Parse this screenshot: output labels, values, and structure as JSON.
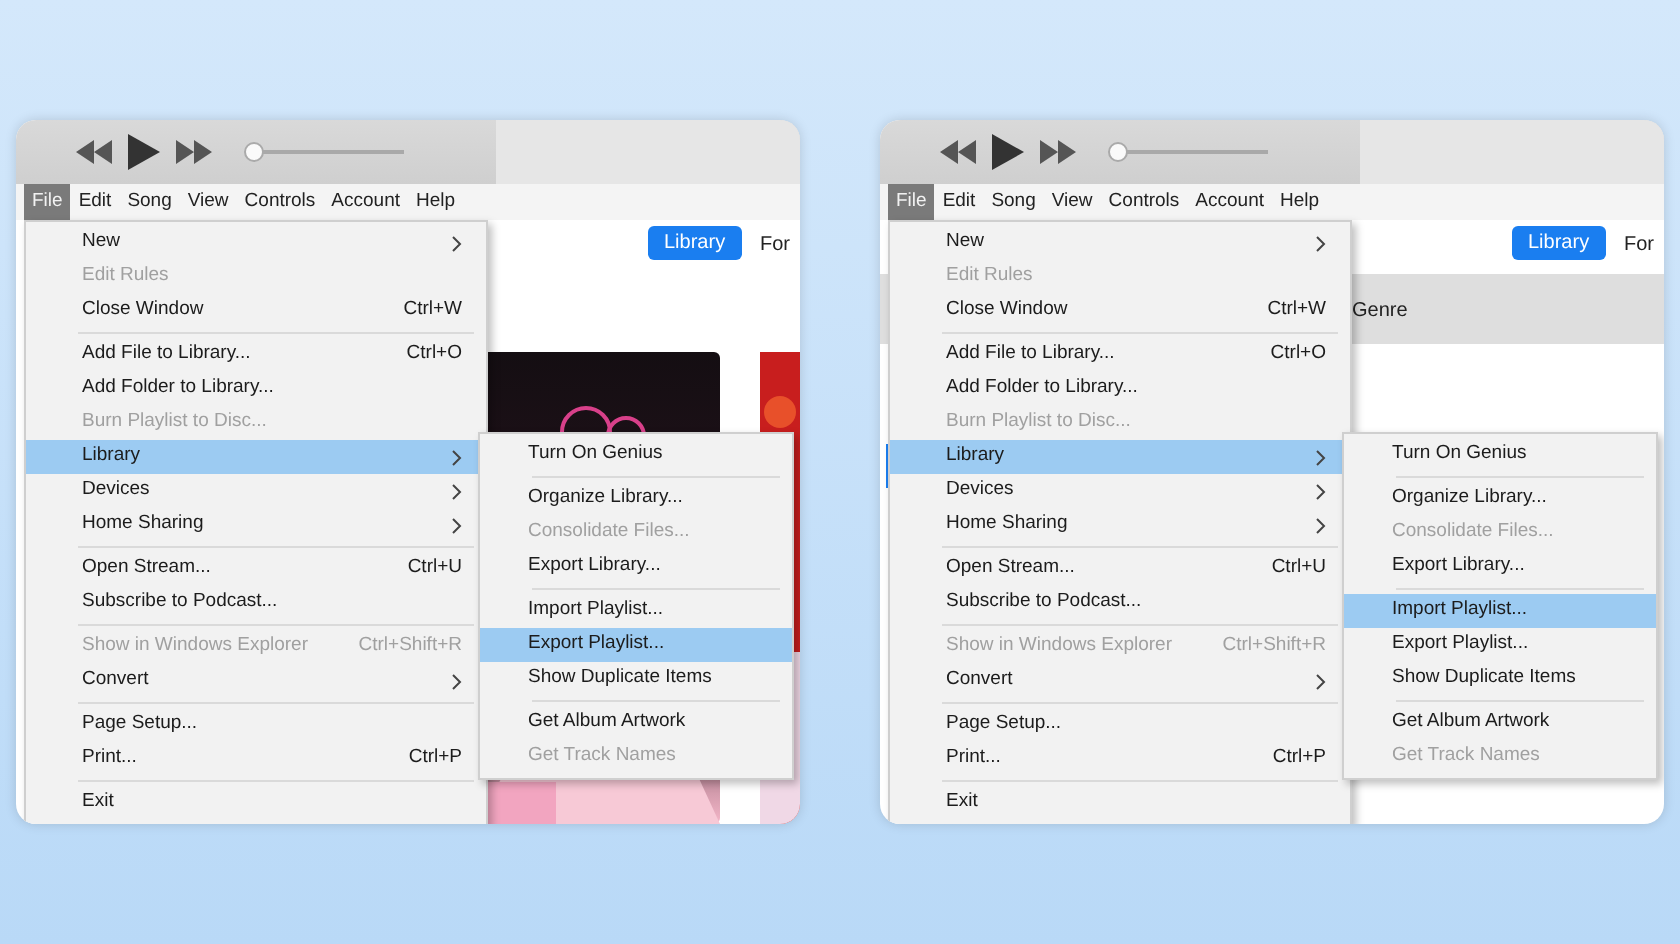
{
  "panels": [
    {
      "volume": {
        "level": 0.0
      },
      "menubar": [
        {
          "label": "File",
          "selected": true
        },
        {
          "label": "Edit",
          "selected": false
        },
        {
          "label": "Song",
          "selected": false
        },
        {
          "label": "View",
          "selected": false
        },
        {
          "label": "Controls",
          "selected": false
        },
        {
          "label": "Account",
          "selected": false
        },
        {
          "label": "Help",
          "selected": false
        }
      ],
      "library_button": "Library",
      "for_tab": "For",
      "file_menu": [
        {
          "kind": "item",
          "label": "New",
          "submenu": true,
          "disabled": false,
          "selected": false
        },
        {
          "kind": "item",
          "label": "Edit Rules",
          "disabled": true,
          "selected": false
        },
        {
          "kind": "item",
          "label": "Close Window",
          "shortcut": "Ctrl+W",
          "disabled": false,
          "selected": false
        },
        {
          "kind": "separator"
        },
        {
          "kind": "item",
          "label": "Add File to Library...",
          "shortcut": "Ctrl+O",
          "disabled": false,
          "selected": false
        },
        {
          "kind": "item",
          "label": "Add Folder to Library...",
          "disabled": false,
          "selected": false
        },
        {
          "kind": "item",
          "label": "Burn Playlist to Disc...",
          "disabled": true,
          "selected": false
        },
        {
          "kind": "item",
          "label": "Library",
          "submenu": true,
          "disabled": false,
          "selected": true
        },
        {
          "kind": "item",
          "label": "Devices",
          "submenu": true,
          "disabled": false,
          "selected": false
        },
        {
          "kind": "item",
          "label": "Home Sharing",
          "submenu": true,
          "disabled": false,
          "selected": false
        },
        {
          "kind": "separator"
        },
        {
          "kind": "item",
          "label": "Open Stream...",
          "shortcut": "Ctrl+U",
          "disabled": false,
          "selected": false
        },
        {
          "kind": "item",
          "label": "Subscribe to Podcast...",
          "disabled": false,
          "selected": false
        },
        {
          "kind": "separator"
        },
        {
          "kind": "item",
          "label": "Show in Windows Explorer",
          "shortcut": "Ctrl+Shift+R",
          "disabled": true,
          "selected": false
        },
        {
          "kind": "item",
          "label": "Convert",
          "submenu": true,
          "disabled": false,
          "selected": false
        },
        {
          "kind": "separator"
        },
        {
          "kind": "item",
          "label": "Page Setup...",
          "disabled": false,
          "selected": false
        },
        {
          "kind": "item",
          "label": "Print...",
          "shortcut": "Ctrl+P",
          "disabled": false,
          "selected": false
        },
        {
          "kind": "separator"
        },
        {
          "kind": "item",
          "label": "Exit",
          "disabled": false,
          "selected": false
        }
      ],
      "library_menu": [
        {
          "kind": "item",
          "label": "Turn On Genius",
          "disabled": false,
          "selected": false
        },
        {
          "kind": "separator"
        },
        {
          "kind": "item",
          "label": "Organize Library...",
          "disabled": false,
          "selected": false
        },
        {
          "kind": "item",
          "label": "Consolidate Files...",
          "disabled": true,
          "selected": false
        },
        {
          "kind": "item",
          "label": "Export Library...",
          "disabled": false,
          "selected": false
        },
        {
          "kind": "separator"
        },
        {
          "kind": "item",
          "label": "Import Playlist...",
          "disabled": false,
          "selected": false
        },
        {
          "kind": "item",
          "label": "Export Playlist...",
          "disabled": false,
          "selected": true
        },
        {
          "kind": "item",
          "label": "Show Duplicate Items",
          "disabled": false,
          "selected": false
        },
        {
          "kind": "separator"
        },
        {
          "kind": "item",
          "label": "Get Album Artwork",
          "disabled": false,
          "selected": false
        },
        {
          "kind": "item",
          "label": "Get Track Names",
          "disabled": true,
          "selected": false
        }
      ]
    },
    {
      "volume": {
        "level": 0.0
      },
      "menubar": [
        {
          "label": "File",
          "selected": true
        },
        {
          "label": "Edit",
          "selected": false
        },
        {
          "label": "Song",
          "selected": false
        },
        {
          "label": "View",
          "selected": false
        },
        {
          "label": "Controls",
          "selected": false
        },
        {
          "label": "Account",
          "selected": false
        },
        {
          "label": "Help",
          "selected": false
        }
      ],
      "library_button": "Library",
      "for_tab": "For",
      "genre_label": "Genre",
      "sidebar_selection": true,
      "file_menu": [
        {
          "kind": "item",
          "label": "New",
          "submenu": true,
          "disabled": false,
          "selected": false
        },
        {
          "kind": "item",
          "label": "Edit Rules",
          "disabled": true,
          "selected": false
        },
        {
          "kind": "item",
          "label": "Close Window",
          "shortcut": "Ctrl+W",
          "disabled": false,
          "selected": false
        },
        {
          "kind": "separator"
        },
        {
          "kind": "item",
          "label": "Add File to Library...",
          "shortcut": "Ctrl+O",
          "disabled": false,
          "selected": false
        },
        {
          "kind": "item",
          "label": "Add Folder to Library...",
          "disabled": false,
          "selected": false
        },
        {
          "kind": "item",
          "label": "Burn Playlist to Disc...",
          "disabled": true,
          "selected": false
        },
        {
          "kind": "item",
          "label": "Library",
          "submenu": true,
          "disabled": false,
          "selected": true
        },
        {
          "kind": "item",
          "label": "Devices",
          "submenu": true,
          "disabled": false,
          "selected": false
        },
        {
          "kind": "item",
          "label": "Home Sharing",
          "submenu": true,
          "disabled": false,
          "selected": false
        },
        {
          "kind": "separator"
        },
        {
          "kind": "item",
          "label": "Open Stream...",
          "shortcut": "Ctrl+U",
          "disabled": false,
          "selected": false
        },
        {
          "kind": "item",
          "label": "Subscribe to Podcast...",
          "disabled": false,
          "selected": false
        },
        {
          "kind": "separator"
        },
        {
          "kind": "item",
          "label": "Show in Windows Explorer",
          "shortcut": "Ctrl+Shift+R",
          "disabled": true,
          "selected": false
        },
        {
          "kind": "item",
          "label": "Convert",
          "submenu": true,
          "disabled": false,
          "selected": false
        },
        {
          "kind": "separator"
        },
        {
          "kind": "item",
          "label": "Page Setup...",
          "disabled": false,
          "selected": false
        },
        {
          "kind": "item",
          "label": "Print...",
          "shortcut": "Ctrl+P",
          "disabled": false,
          "selected": false
        },
        {
          "kind": "separator"
        },
        {
          "kind": "item",
          "label": "Exit",
          "disabled": false,
          "selected": false
        }
      ],
      "library_menu": [
        {
          "kind": "item",
          "label": "Turn On Genius",
          "disabled": false,
          "selected": false
        },
        {
          "kind": "separator"
        },
        {
          "kind": "item",
          "label": "Organize Library...",
          "disabled": false,
          "selected": false
        },
        {
          "kind": "item",
          "label": "Consolidate Files...",
          "disabled": true,
          "selected": false
        },
        {
          "kind": "item",
          "label": "Export Library...",
          "disabled": false,
          "selected": false
        },
        {
          "kind": "separator"
        },
        {
          "kind": "item",
          "label": "Import Playlist...",
          "disabled": false,
          "selected": true
        },
        {
          "kind": "item",
          "label": "Export Playlist...",
          "disabled": false,
          "selected": false
        },
        {
          "kind": "item",
          "label": "Show Duplicate Items",
          "disabled": false,
          "selected": false
        },
        {
          "kind": "separator"
        },
        {
          "kind": "item",
          "label": "Get Album Artwork",
          "disabled": false,
          "selected": false
        },
        {
          "kind": "item",
          "label": "Get Track Names",
          "disabled": true,
          "selected": false
        }
      ]
    }
  ]
}
